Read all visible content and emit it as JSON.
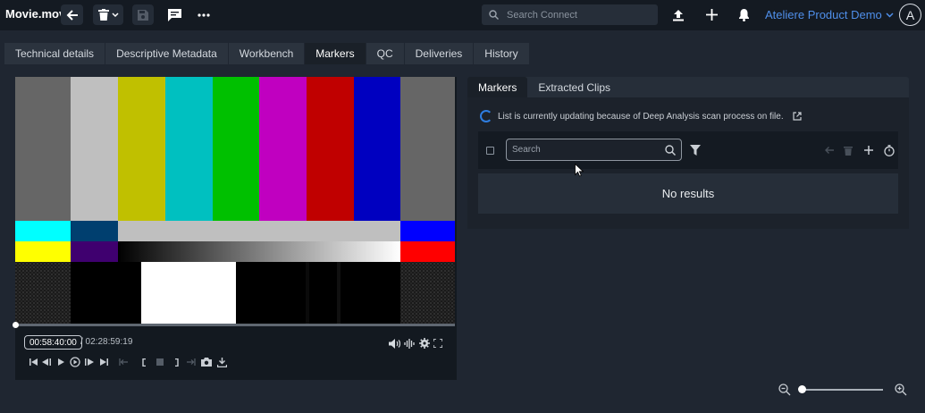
{
  "header": {
    "file_title": "Movie.mov",
    "search_placeholder": "Search Connect",
    "org_name": "Ateliere Product Demo",
    "avatar_initial": "A"
  },
  "tabs": [
    {
      "label": "Technical details",
      "active": false
    },
    {
      "label": "Descriptive Metadata",
      "active": false
    },
    {
      "label": "Workbench",
      "active": false
    },
    {
      "label": "Markers",
      "active": true
    },
    {
      "label": "QC",
      "active": false
    },
    {
      "label": "Deliveries",
      "active": false
    },
    {
      "label": "History",
      "active": false
    }
  ],
  "player": {
    "timecode": "00:58:40:00",
    "duration": "/ 02:28:59:19"
  },
  "markers_panel": {
    "tabs": [
      {
        "label": "Markers",
        "active": true
      },
      {
        "label": "Extracted Clips",
        "active": false
      }
    ],
    "notice": "List is currently updating because of Deep Analysis scan process on file.",
    "search_placeholder": "Search",
    "empty_text": "No results"
  },
  "colors": {
    "accent": "#4f8fea",
    "spinner": "#2e7de0",
    "background": "#1f2631",
    "topbar": "#141a22"
  }
}
